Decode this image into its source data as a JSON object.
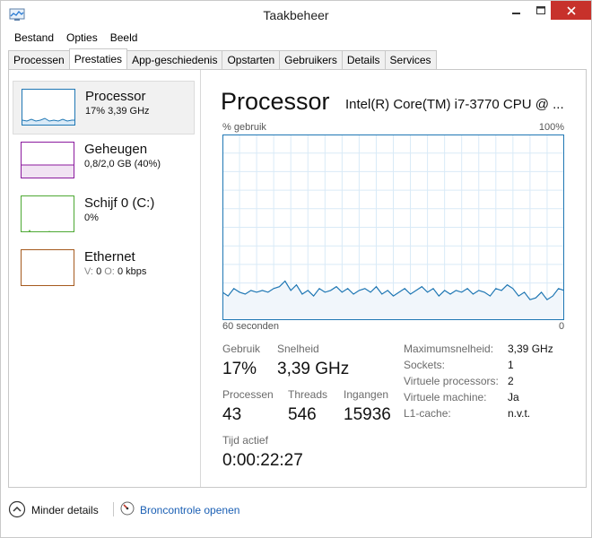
{
  "window": {
    "title": "Taakbeheer"
  },
  "menu": [
    "Bestand",
    "Opties",
    "Beeld"
  ],
  "tabs": [
    {
      "label": "Processen",
      "active": false
    },
    {
      "label": "Prestaties",
      "active": true
    },
    {
      "label": "App-geschiedenis",
      "active": false
    },
    {
      "label": "Opstarten",
      "active": false
    },
    {
      "label": "Gebruikers",
      "active": false
    },
    {
      "label": "Details",
      "active": false
    },
    {
      "label": "Services",
      "active": false
    }
  ],
  "sidebar": {
    "items": [
      {
        "title": "Processor",
        "subtitle": "17% 3,39 GHz",
        "color": "#1f77b4",
        "selected": true
      },
      {
        "title": "Geheugen",
        "subtitle": "0,8/2,0 GB (40%)",
        "color": "#8b1a9e",
        "selected": false
      },
      {
        "title": "Schijf 0 (C:)",
        "subtitle": "0%",
        "color": "#4da833",
        "selected": false
      },
      {
        "title": "Ethernet",
        "subtitle_parts": [
          "V:",
          "0",
          "O:",
          "0 kbps"
        ],
        "color": "#a55a1e",
        "selected": false
      }
    ]
  },
  "main": {
    "title": "Processor",
    "cpu_name": "Intel(R) Core(TM) i7-3770 CPU @ ...",
    "axis": {
      "top_left": "% gebruik",
      "top_right": "100%",
      "bottom_left": "60 seconden",
      "bottom_right": "0"
    },
    "stats": [
      {
        "label": "Gebruik",
        "value": "17%"
      },
      {
        "label": "Snelheid",
        "value": "3,39 GHz"
      },
      {
        "label": "Processen",
        "value": "43"
      },
      {
        "label": "Threads",
        "value": "546"
      },
      {
        "label": "Ingangen",
        "value": "15936"
      },
      {
        "label": "Tijd actief",
        "value": "0:00:22:27"
      }
    ],
    "specs": [
      {
        "label": "Maximumsnelheid:",
        "value": "3,39 GHz"
      },
      {
        "label": "Sockets:",
        "value": "1"
      },
      {
        "label": "Virtuele processors:",
        "value": "2"
      },
      {
        "label": "Virtuele machine:",
        "value": "Ja"
      },
      {
        "label": "L1-cache:",
        "value": "n.v.t."
      }
    ]
  },
  "chart_data": {
    "type": "area",
    "ylabel": "% gebruik",
    "ylim": [
      0,
      100
    ],
    "xlim": [
      60,
      0
    ],
    "color": "#1f77b4",
    "x": [
      60,
      59,
      58,
      57,
      56,
      55,
      54,
      53,
      52,
      51,
      50,
      49,
      48,
      47,
      46,
      45,
      44,
      43,
      42,
      41,
      40,
      39,
      38,
      37,
      36,
      35,
      34,
      33,
      32,
      31,
      30,
      29,
      28,
      27,
      26,
      25,
      24,
      23,
      22,
      21,
      20,
      19,
      18,
      17,
      16,
      15,
      14,
      13,
      12,
      11,
      10,
      9,
      8,
      7,
      6,
      5,
      4,
      3,
      2,
      1,
      0
    ],
    "y": [
      15,
      13,
      17,
      15,
      14,
      16,
      15,
      16,
      15,
      17,
      18,
      21,
      16,
      19,
      14,
      16,
      13,
      17,
      15,
      16,
      18,
      15,
      17,
      14,
      16,
      17,
      15,
      18,
      14,
      16,
      13,
      15,
      17,
      14,
      16,
      18,
      15,
      17,
      13,
      16,
      14,
      16,
      15,
      17,
      14,
      16,
      15,
      13,
      17,
      16,
      19,
      17,
      13,
      15,
      11,
      12,
      15,
      11,
      13,
      17,
      16
    ]
  },
  "footer": {
    "fewer_details": "Minder details",
    "resource_monitor": "Broncontrole openen"
  }
}
